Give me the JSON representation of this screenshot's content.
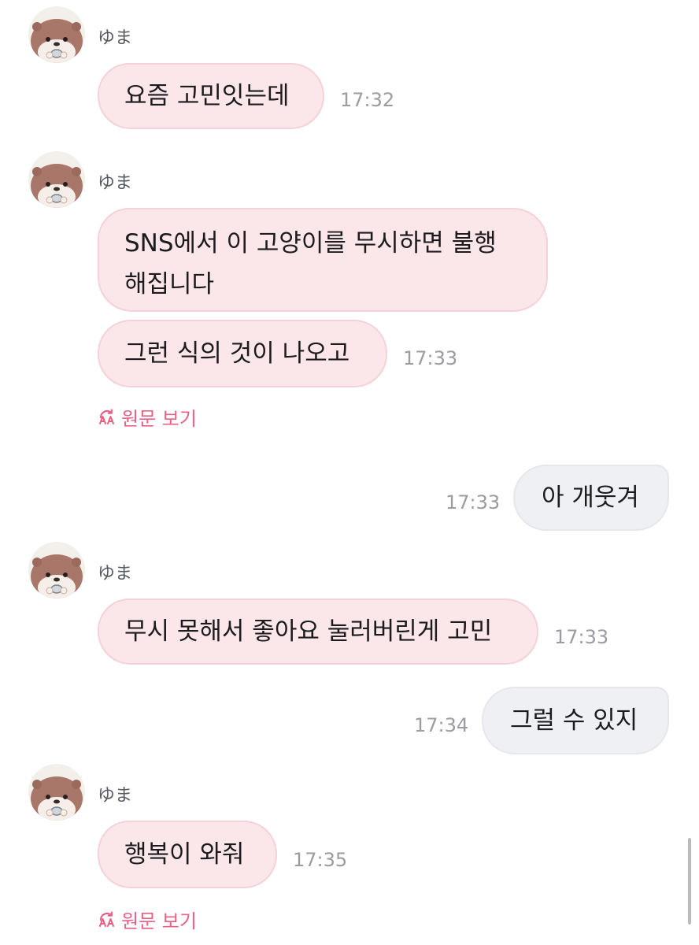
{
  "colors": {
    "incoming_bubble": "#fbe6ea",
    "outgoing_bubble": "#eff0f4",
    "translate_accent": "#ea5f83",
    "timestamp": "#9a9ca1"
  },
  "messages": [
    {
      "sender": "ゆま",
      "avatar_icon": "otter-avatar-icon",
      "text": "요즘 고민잇는데",
      "time": "17:32"
    },
    {
      "sender": "ゆま",
      "avatar_icon": "otter-avatar-icon",
      "text_line1": "SNS에서 이 고양이를 무시하면 불행",
      "text_line2": "해집니다"
    },
    {
      "text": "그런 식의 것이 나오고",
      "time": "17:33",
      "view_original": "원문 보기",
      "view_original_icon": "translate-icon"
    },
    {
      "direction": "outgoing",
      "text": "아 개웃겨",
      "time": "17:33"
    },
    {
      "sender": "ゆま",
      "avatar_icon": "otter-avatar-icon",
      "text": "무시 못해서 좋아요 눌러버린게 고민",
      "time": "17:33"
    },
    {
      "direction": "outgoing",
      "text": "그럴 수 있지",
      "time": "17:34"
    },
    {
      "sender": "ゆま",
      "avatar_icon": "otter-avatar-icon",
      "text": "행복이 와줘",
      "time": "17:35",
      "view_original": "원문 보기",
      "view_original_icon": "translate-icon"
    }
  ]
}
